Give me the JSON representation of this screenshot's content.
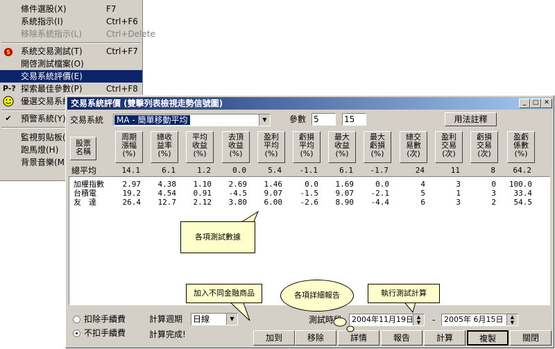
{
  "menu": {
    "items": [
      {
        "label": "條件選股(X)",
        "shortcut": "F7",
        "icon": ""
      },
      {
        "label": "系統指示(I)",
        "shortcut": "Ctrl+F6",
        "icon": ""
      },
      {
        "label": "移除系統指示(L)",
        "shortcut": "Ctrl+Delete",
        "icon": "",
        "disabled": true
      },
      {
        "label": "系統交易測試(T)",
        "shortcut": "Ctrl+F7",
        "icon": "money-bag-icon"
      },
      {
        "label": "開啓測試檔案(O)",
        "shortcut": "",
        "icon": ""
      },
      {
        "label": "交易系統評價(E)",
        "shortcut": "",
        "icon": "",
        "selected": true
      },
      {
        "label": "探索最佳參數(P)",
        "shortcut": "Ctrl+F8",
        "icon": "optimize-icon",
        "icon_text": "P-?"
      },
      {
        "label": "優選交易系統",
        "shortcut": "",
        "icon": "smiley-icon"
      },
      {
        "label": "預警系統(Y)",
        "shortcut": "",
        "icon": "checkmark-icon"
      },
      {
        "label": "監視剪貼板(",
        "shortcut": "",
        "icon": ""
      },
      {
        "label": "跑馬燈(H)",
        "shortcut": "",
        "icon": ""
      },
      {
        "label": "背景音樂(M",
        "shortcut": "",
        "icon": ""
      }
    ]
  },
  "dialog": {
    "title": "交易系統評價 (雙擊列表檢視走勢信號圖)",
    "system_label": "交易系統",
    "system_value": "MA - 簡單移動平均",
    "param_label": "參數",
    "param1": "5",
    "param2": "15",
    "help_button": "用法註釋",
    "stock_header": [
      "股票",
      "名稱"
    ],
    "columns": [
      [
        "周期",
        "漲幅",
        "(%)"
      ],
      [
        "總收",
        "益率",
        "(%)"
      ],
      [
        "平均",
        "收益",
        "(%)"
      ],
      [
        "去頂",
        "收益",
        "(%)"
      ],
      [
        "盈利",
        "平均",
        "(%)"
      ],
      [
        "虧損",
        "平均",
        "(%)"
      ],
      [
        "最大",
        "收益",
        "(%)"
      ],
      [
        "最大",
        "虧損",
        "(%)"
      ],
      [
        "總交",
        "易數",
        "(次)"
      ],
      [
        "盈利",
        "交易",
        "(次)"
      ],
      [
        "虧損",
        "交易",
        "(次)"
      ],
      [
        "盈虧",
        "係數",
        "(%)"
      ]
    ],
    "average_label": "總平均",
    "average_values": [
      "14.1",
      "6.1",
      "1.2",
      "0.0",
      "5.4",
      "-1.1",
      "6.1",
      "-1.7",
      "24",
      "11",
      "8",
      "64.2"
    ],
    "rows": [
      {
        "name": "加權指數",
        "values": [
          "2.97",
          "4.38",
          "1.10",
          "2.69",
          "1.46",
          "0.0",
          "1.69",
          "0.0",
          "4",
          "3",
          "0",
          "100.0"
        ]
      },
      {
        "name": "台積電",
        "values": [
          "19.2",
          "4.54",
          "0.91",
          "-4.5",
          "9.07",
          "-1.5",
          "9.07",
          "-2.1",
          "5",
          "1",
          "3",
          "33.4"
        ]
      },
      {
        "name": "友　達",
        "values": [
          "26.4",
          "12.7",
          "2.12",
          "3.80",
          "6.00",
          "-2.6",
          "8.90",
          "-4.4",
          "6",
          "3",
          "2",
          "54.5"
        ]
      }
    ],
    "fee_options": [
      "扣除手續費",
      "不扣手續費"
    ],
    "fee_selected": 1,
    "period_label": "計算週期",
    "period_value": "日線",
    "status": "計算完成!",
    "test_period_label": "測試時段",
    "date_from": "2004年11月19日",
    "date_sep": "-",
    "date_to": "2005年  6月15日",
    "buttons": [
      "加到",
      "移除",
      "詳情",
      "報告",
      "計算",
      "複製",
      "關閉"
    ]
  },
  "callouts": {
    "data": "各項測試數據",
    "add": "加入不同金融商品",
    "report": "各項詳細報告",
    "execute": "執行測試計算"
  }
}
